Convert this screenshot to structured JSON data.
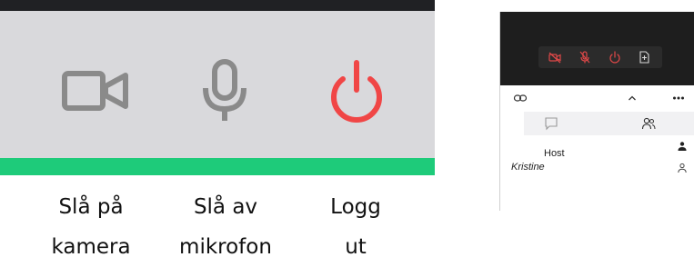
{
  "toolbar_zoom": {
    "buttons": [
      {
        "icon": "video-camera-icon",
        "caption_line1": "Slå på",
        "caption_line2": "kamera"
      },
      {
        "icon": "microphone-icon",
        "caption_line1": "Slå av",
        "caption_line2": "mikrofon"
      },
      {
        "icon": "power-icon",
        "caption_line1": "Logg",
        "caption_line2": "ut"
      }
    ],
    "colors": {
      "panel": "#d9d9dc",
      "icon_gray": "#8a8a8a",
      "logout_red": "#f04646",
      "accent_green": "#1ecb7a",
      "dark_bar": "#202124"
    }
  },
  "phone": {
    "controls": [
      "camera-off-icon",
      "mic-off-icon",
      "power-icon",
      "share-file-icon"
    ],
    "toolbar_icons": [
      "link-icon",
      "chevron-up-icon",
      "more-icon"
    ],
    "tabs": [
      "chat-icon",
      "participants-icon"
    ],
    "participants": {
      "host_label": "Host",
      "name": "Kristine"
    },
    "colors": {
      "control_red": "#e04848",
      "video_bg": "#1e1e1e"
    }
  }
}
